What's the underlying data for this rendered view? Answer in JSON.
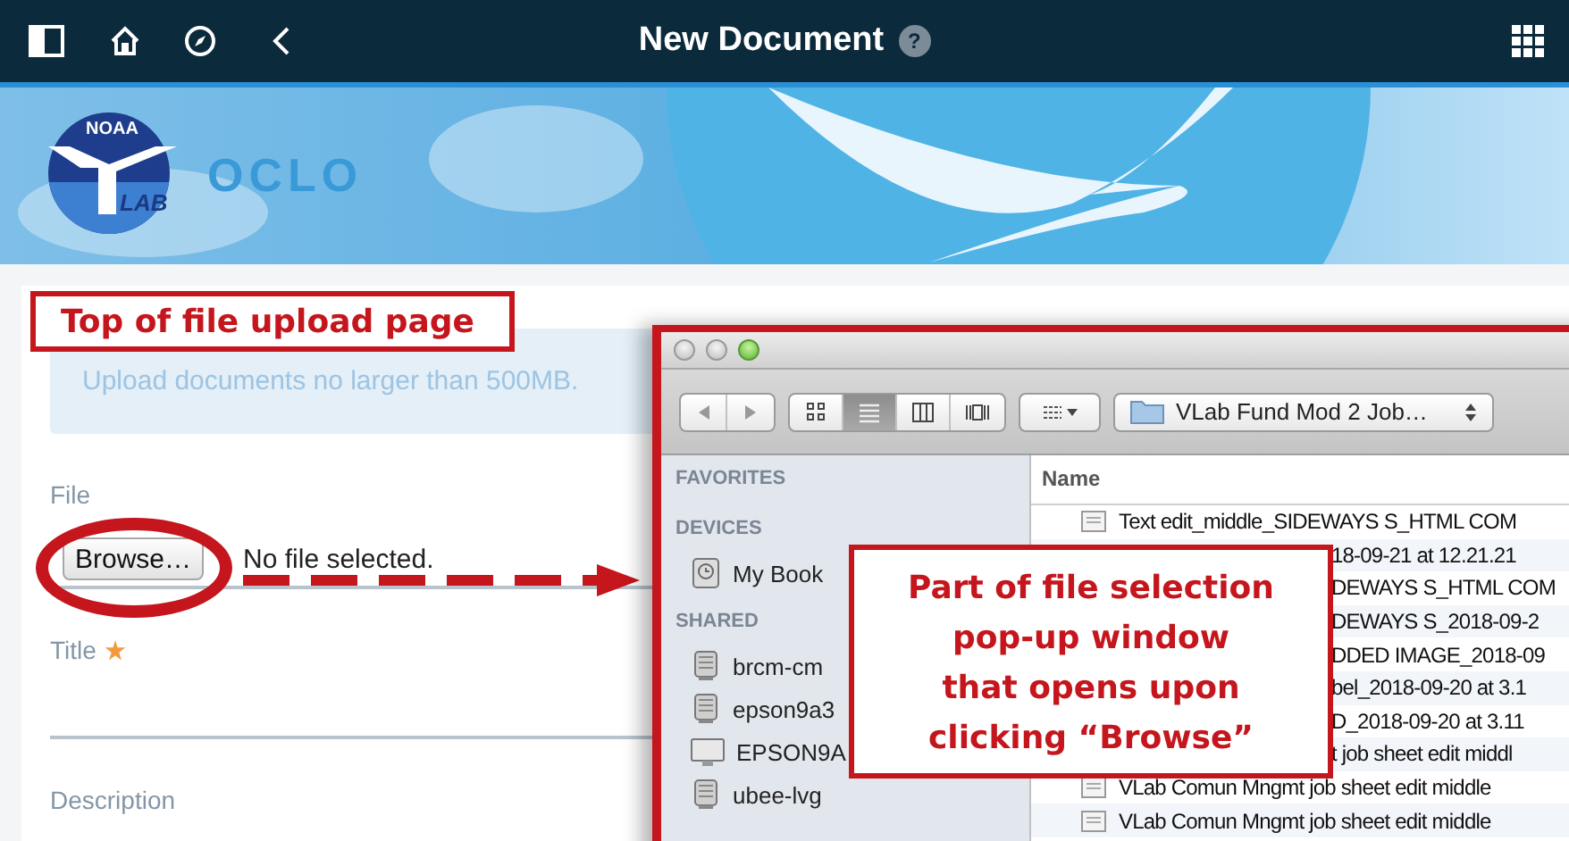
{
  "topbar": {
    "title": "New Document",
    "help": "?"
  },
  "banner": {
    "logo": {
      "top": "NOAA",
      "bottom": "LAB"
    },
    "site_name": "OCLO"
  },
  "form": {
    "notice": "Upload documents no larger than 500MB.",
    "fields": [
      {
        "kind": "file",
        "label": "File",
        "button": "Browse…",
        "status": "No file selected.",
        "required": false
      },
      {
        "kind": "text",
        "label": "Title",
        "required": true
      },
      {
        "kind": "text",
        "label": "Description",
        "required": false
      }
    ]
  },
  "file_dialog": {
    "controls": [
      {
        "enabled": false
      },
      {
        "enabled": false
      },
      {
        "enabled": true
      }
    ],
    "view_modes": [
      {
        "kind": "icons",
        "selected": false
      },
      {
        "kind": "list",
        "selected": true
      },
      {
        "kind": "columns",
        "selected": false
      },
      {
        "kind": "coverflow",
        "selected": false
      }
    ],
    "location": "VLab Fund Mod 2 Job…",
    "sidebar": [
      {
        "heading": "FAVORITES"
      },
      {
        "heading": "DEVICES",
        "items": [
          {
            "name": "My Book",
            "kind": "disk"
          }
        ]
      },
      {
        "heading": "SHARED",
        "items": [
          {
            "name": "brcm-cm",
            "kind": "server"
          },
          {
            "name": "epson9a3",
            "kind": "server"
          },
          {
            "name": "EPSON9A",
            "kind": "display"
          },
          {
            "name": "ubee-lvg",
            "kind": "server"
          }
        ]
      }
    ],
    "list": {
      "column": "Name",
      "rows": [
        {
          "name": "Text edit_middle_SIDEWAYS S_HTML COM",
          "kind": "full"
        },
        {
          "name": "18-09-21 at 12.21.21",
          "kind": "partial"
        },
        {
          "name": "DEWAYS S_HTML COM",
          "kind": "partial"
        },
        {
          "name": "DEWAYS S_2018-09-2",
          "kind": "partial"
        },
        {
          "name": "DDED IMAGE_2018-09",
          "kind": "partial"
        },
        {
          "name": "bel_2018-09-20 at 3.1",
          "kind": "partial"
        },
        {
          "name": "D_2018-09-20 at 3.11",
          "kind": "partial"
        },
        {
          "name": "t job sheet edit middl",
          "kind": "partial"
        },
        {
          "name": "VLab Comun Mngmt job sheet edit middle",
          "kind": "full"
        },
        {
          "name": "VLab Comun Mngmt job sheet edit middle",
          "kind": "full"
        }
      ]
    }
  },
  "annotations": {
    "page_label": "Top of file upload page",
    "dialog_label": [
      "Part of file selection",
      "pop-up window",
      "that opens upon",
      "clicking “Browse”"
    ]
  }
}
